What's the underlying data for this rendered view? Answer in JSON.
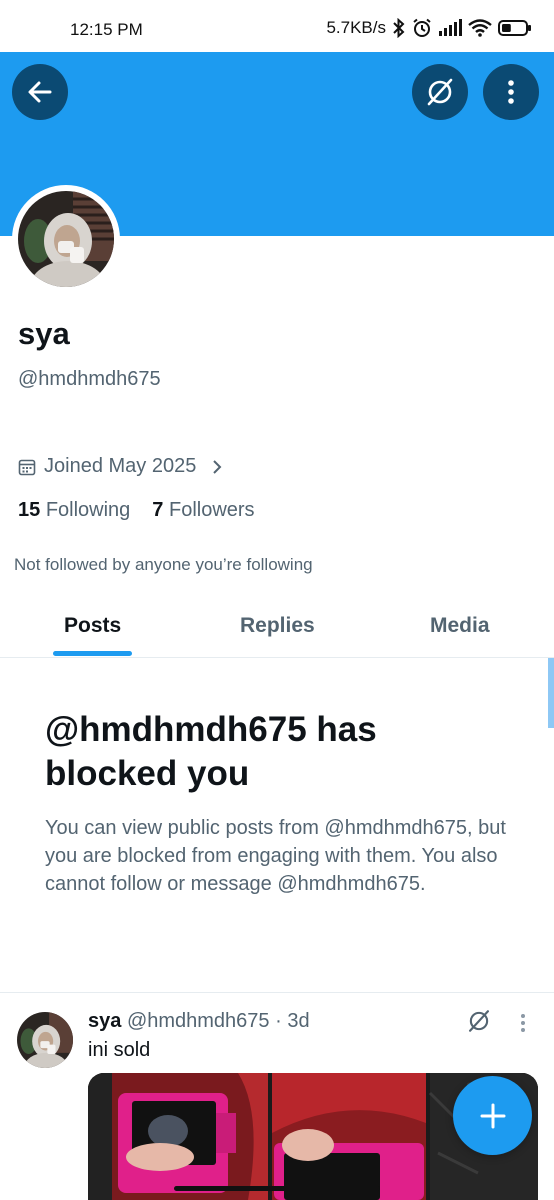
{
  "status_bar": {
    "time": "12:15 PM",
    "speed": "5.7KB/s",
    "battery_level": 0.4
  },
  "profile": {
    "display_name": "sya",
    "handle": "@hmdhmdh675",
    "joined": "Joined May 2025",
    "following_count": "15",
    "following_label": "Following",
    "followers_count": "7",
    "followers_label": "Followers",
    "not_followed": "Not followed by anyone you’re following"
  },
  "tabs": [
    {
      "label": "Posts",
      "active": true
    },
    {
      "label": "Replies",
      "active": false
    },
    {
      "label": "Media",
      "active": false
    }
  ],
  "blocked": {
    "title": "@hmdhmdh675 has blocked you",
    "message": "You can view public posts from @hmdhmdh675, but you are blocked from engaging with them. You also cannot follow or message @hmdhmdh675."
  },
  "post": {
    "name": "sya",
    "handle": "@hmdhmdh675",
    "time": "· 3d",
    "text": "ini sold"
  },
  "colors": {
    "accent": "#1d9bf0",
    "banner": "#1d9bf0",
    "header_button": "#0b4a73",
    "secondary_text": "#536471",
    "primary_text": "#0f1419",
    "camera_pink": "#e0208a"
  },
  "icons": {
    "back": "arrow-left-icon",
    "grok": "grok-icon",
    "more": "more-vertical-icon",
    "calendar": "calendar-icon",
    "chevron": "chevron-right-icon",
    "compose": "plus-icon"
  }
}
